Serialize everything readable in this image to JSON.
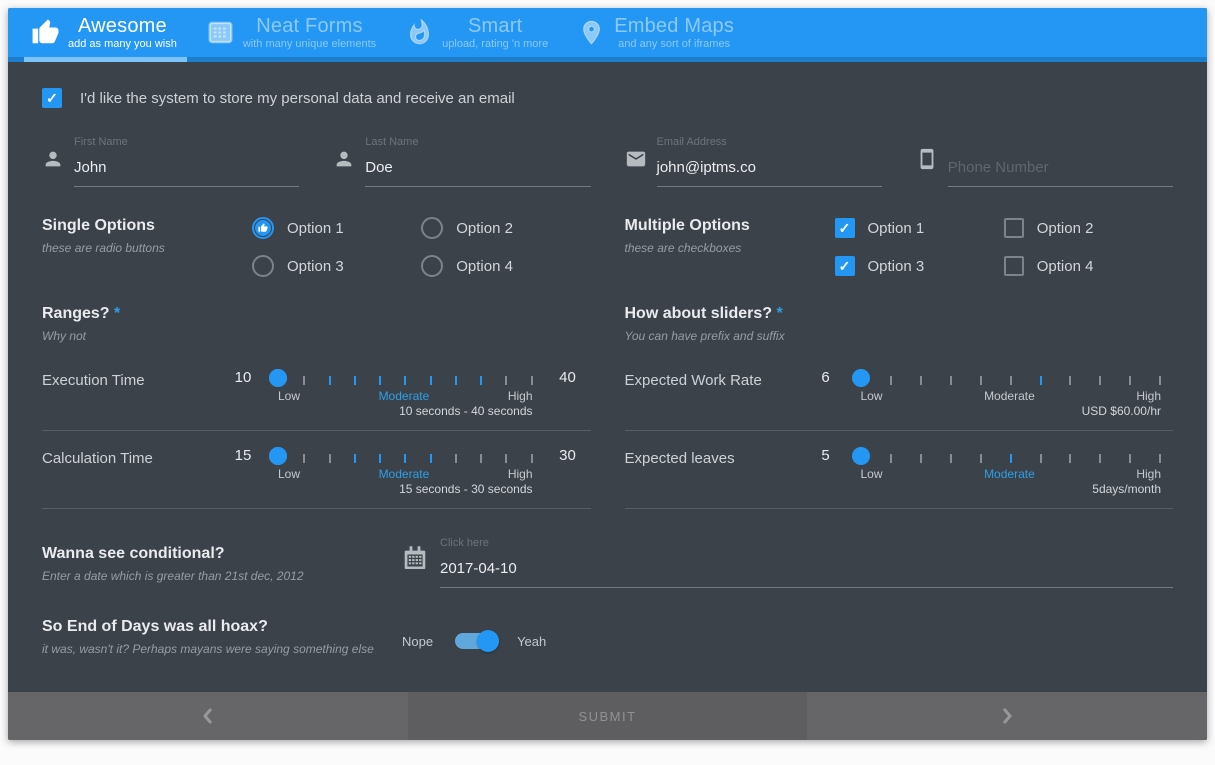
{
  "colors": {
    "accent": "#2397f3",
    "accent_light": "#7ec3f7",
    "header_bg": "#2397f3",
    "header_strip": "#1d7ecc",
    "form_bg": "#3b424a",
    "footer_bg": "#666668",
    "footer_mid_bg": "#5e5e60"
  },
  "header": {
    "tabs": [
      {
        "title": "Awesome",
        "subtitle": "add as many you wish",
        "icon": "thumbs-up-icon",
        "active": true
      },
      {
        "title": "Neat Forms",
        "subtitle": "with many unique elements",
        "icon": "form-icon",
        "active": false
      },
      {
        "title": "Smart",
        "subtitle": "upload, rating 'n more",
        "icon": "flame-icon",
        "active": false
      },
      {
        "title": "Embed Maps",
        "subtitle": "and any sort of iframes",
        "icon": "map-pin-icon",
        "active": false
      }
    ]
  },
  "consent": {
    "checked": true,
    "label": "I'd like the system to store my personal data and receive an email"
  },
  "fields": [
    {
      "label": "First Name",
      "value": "John",
      "icon": "person-icon"
    },
    {
      "label": "Last Name",
      "value": "Doe",
      "icon": "person-icon"
    },
    {
      "label": "Email Address",
      "value": "john@iptms.co",
      "icon": "envelope-icon"
    },
    {
      "label": "",
      "value": "",
      "placeholder": "Phone Number",
      "icon": "phone-icon"
    }
  ],
  "single_options": {
    "title": "Single Options",
    "subtitle": "these are radio buttons",
    "options": [
      {
        "label": "Option 1",
        "selected": true
      },
      {
        "label": "Option 2",
        "selected": false
      },
      {
        "label": "Option 3",
        "selected": false
      },
      {
        "label": "Option 4",
        "selected": false
      }
    ]
  },
  "multiple_options": {
    "title": "Multiple Options",
    "subtitle": "these are checkboxes",
    "options": [
      {
        "label": "Option 1",
        "checked": true
      },
      {
        "label": "Option 2",
        "checked": false
      },
      {
        "label": "Option 3",
        "checked": true
      },
      {
        "label": "Option 4",
        "checked": false
      }
    ]
  },
  "sections": {
    "ranges": {
      "title": "Ranges?",
      "required_mark": "*",
      "subtitle": "Why not"
    },
    "sliders": {
      "title": "How about sliders?",
      "required_mark": "*",
      "subtitle": "You can have prefix and suffix"
    }
  },
  "slider_scale": {
    "low": "Low",
    "mid": "Moderate",
    "high": "High"
  },
  "sliders": [
    {
      "label": "Execution Time",
      "type": "range",
      "min": 0,
      "max": 50,
      "low": 10,
      "high": 40,
      "left_value": "10",
      "right_value": "40",
      "moderate_highlight": true,
      "note": "10 seconds - 40 seconds"
    },
    {
      "label": "Expected Work Rate",
      "type": "single",
      "min": 0,
      "max": 10,
      "value": 6,
      "left_value": "6",
      "moderate_highlight": false,
      "note": "USD $60.00/hr"
    },
    {
      "label": "Calculation Time",
      "type": "range",
      "min": 0,
      "max": 50,
      "low": 15,
      "high": 30,
      "left_value": "15",
      "right_value": "30",
      "moderate_highlight": true,
      "note": "15 seconds - 30 seconds"
    },
    {
      "label": "Expected leaves",
      "type": "single",
      "min": 0,
      "max": 10,
      "value": 5,
      "left_value": "5",
      "moderate_highlight": true,
      "note": "5days/month"
    }
  ],
  "conditional": {
    "title": "Wanna see conditional?",
    "subtitle": "Enter a date which is greater than 21st dec, 2012",
    "field_label": "Click here",
    "value": "2017-04-10",
    "icon": "calendar-icon"
  },
  "hoax": {
    "title": "So End of Days was all hoax?",
    "subtitle": "it was, wasn't it? Perhaps mayans were saying something else",
    "off_label": "Nope",
    "on_label": "Yeah",
    "state": "on"
  },
  "footer": {
    "submit_label": "SUBMIT"
  }
}
